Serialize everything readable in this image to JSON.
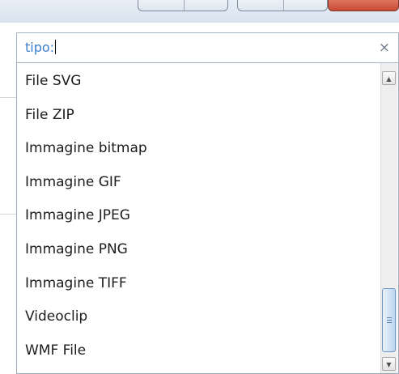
{
  "search": {
    "value": "tipo:",
    "clear_glyph": "×"
  },
  "list": {
    "items": [
      "File SVG",
      "File ZIP",
      "Immagine bitmap",
      "Immagine GIF",
      "Immagine JPEG",
      "Immagine PNG",
      "Immagine TIFF",
      "Videoclip",
      "WMF File"
    ]
  },
  "scrollbar": {
    "up_arrow": "▲",
    "down_arrow": "▼"
  },
  "colors": {
    "search_text": "#3a7fd0",
    "item_text": "#1c1c1c",
    "thumb": "#bcd6f1"
  }
}
